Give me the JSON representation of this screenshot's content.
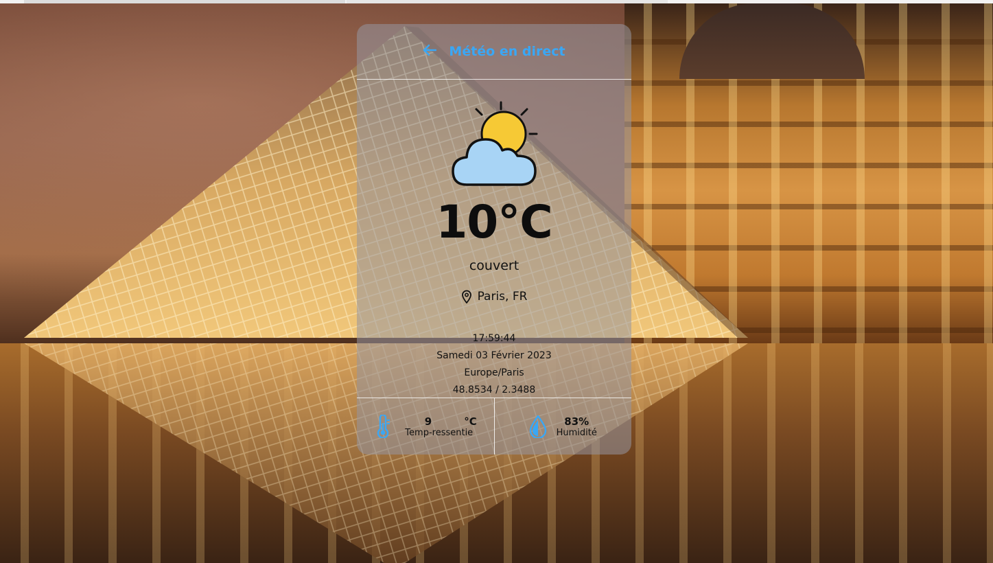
{
  "app": {
    "title": "Météo en direct",
    "back_icon": "arrow-left-icon",
    "accent_color": "#3aa7f5"
  },
  "weather": {
    "icon": "partly-cloudy-icon",
    "temperature": "10°C",
    "condition": "couvert",
    "location_icon": "map-pin-icon",
    "location": "Paris, FR",
    "time": "17:59:44",
    "date": "Samedi 03 Février 2023",
    "timezone": "Europe/Paris",
    "coordinates": "48.8534 / 2.3488"
  },
  "stats": {
    "feels_like": {
      "icon": "thermometer-icon",
      "value": "9",
      "unit": "°C",
      "label": "Temp-ressentie"
    },
    "humidity": {
      "icon": "water-drop-icon",
      "value": "83%",
      "label": "Humidité"
    }
  }
}
